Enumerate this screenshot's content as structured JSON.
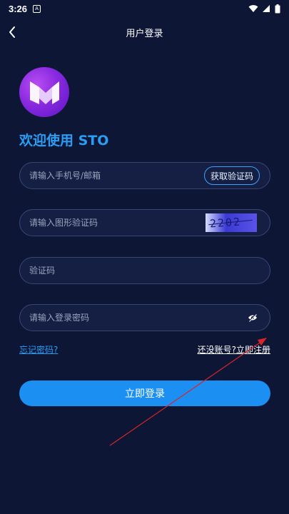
{
  "status_bar": {
    "time": "3:26",
    "notif_glyph": "A"
  },
  "header": {
    "title": "用户登录"
  },
  "welcome": "欢迎使用 STO",
  "form": {
    "account": {
      "placeholder": "请输入手机号/邮箱",
      "value": ""
    },
    "get_code_label": "获取验证码",
    "captcha": {
      "placeholder": "请输入图形验证码",
      "value": "",
      "image_text": "2202"
    },
    "sms_code": {
      "placeholder": "验证码",
      "value": ""
    },
    "password": {
      "placeholder": "请输入登录密码",
      "value": ""
    }
  },
  "links": {
    "forgot": "忘记密码?",
    "register": "还没账号?立即注册"
  },
  "login_button": "立即登录",
  "colors": {
    "background": "#0e1636",
    "accent": "#2a9df4",
    "button": "#1c8ff2",
    "annotation_arrow": "#d9252a"
  },
  "icons": [
    "back-arrow-icon",
    "wifi-icon",
    "signal-icon",
    "battery-icon",
    "app-logo-icon",
    "eye-off-icon"
  ]
}
